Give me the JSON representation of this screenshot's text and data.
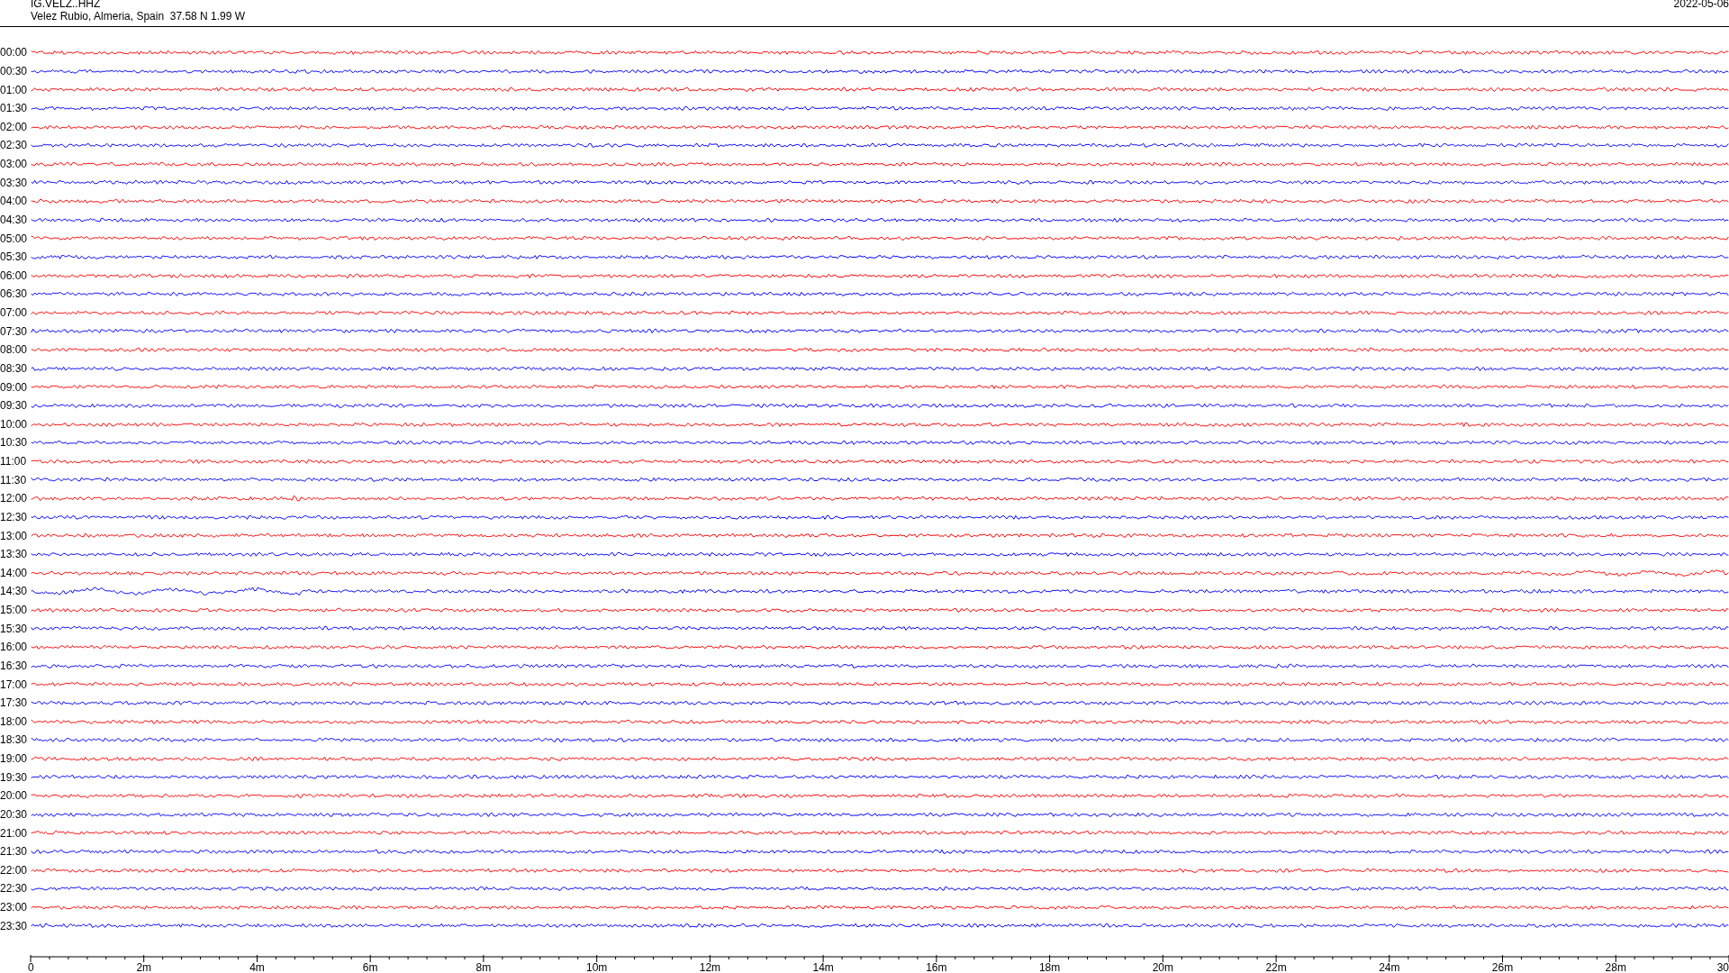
{
  "header": {
    "station": "IG.VELZ..HHZ",
    "location": "Velez Rubio, Almeria, Spain  37.58 N 1.99 W",
    "date": "2022-05-06"
  },
  "rows": [
    {
      "label": "00:00",
      "color": "#ff0000"
    },
    {
      "label": "00:30",
      "color": "#0000ff"
    },
    {
      "label": "01:00",
      "color": "#ff0000"
    },
    {
      "label": "01:30",
      "color": "#0000ff"
    },
    {
      "label": "02:00",
      "color": "#ff0000"
    },
    {
      "label": "02:30",
      "color": "#0000ff"
    },
    {
      "label": "03:00",
      "color": "#ff0000"
    },
    {
      "label": "03:30",
      "color": "#0000ff"
    },
    {
      "label": "04:00",
      "color": "#ff0000"
    },
    {
      "label": "04:30",
      "color": "#0000ff"
    },
    {
      "label": "05:00",
      "color": "#ff0000"
    },
    {
      "label": "05:30",
      "color": "#0000ff"
    },
    {
      "label": "06:00",
      "color": "#ff0000"
    },
    {
      "label": "06:30",
      "color": "#0000ff"
    },
    {
      "label": "07:00",
      "color": "#ff0000"
    },
    {
      "label": "07:30",
      "color": "#0000ff"
    },
    {
      "label": "08:00",
      "color": "#ff0000"
    },
    {
      "label": "08:30",
      "color": "#0000ff"
    },
    {
      "label": "09:00",
      "color": "#ff0000"
    },
    {
      "label": "09:30",
      "color": "#0000ff"
    },
    {
      "label": "10:00",
      "color": "#ff0000"
    },
    {
      "label": "10:30",
      "color": "#0000ff"
    },
    {
      "label": "11:00",
      "color": "#ff0000"
    },
    {
      "label": "11:30",
      "color": "#0000ff"
    },
    {
      "label": "12:00",
      "color": "#ff0000"
    },
    {
      "label": "12:30",
      "color": "#0000ff"
    },
    {
      "label": "13:00",
      "color": "#ff0000"
    },
    {
      "label": "13:30",
      "color": "#0000ff"
    },
    {
      "label": "14:00",
      "color": "#ff0000"
    },
    {
      "label": "14:30",
      "color": "#0000ff"
    },
    {
      "label": "15:00",
      "color": "#ff0000"
    },
    {
      "label": "15:30",
      "color": "#0000ff"
    },
    {
      "label": "16:00",
      "color": "#ff0000"
    },
    {
      "label": "16:30",
      "color": "#0000ff"
    },
    {
      "label": "17:00",
      "color": "#ff0000"
    },
    {
      "label": "17:30",
      "color": "#0000ff"
    },
    {
      "label": "18:00",
      "color": "#ff0000"
    },
    {
      "label": "18:30",
      "color": "#0000ff"
    },
    {
      "label": "19:00",
      "color": "#ff0000"
    },
    {
      "label": "19:30",
      "color": "#0000ff"
    },
    {
      "label": "20:00",
      "color": "#ff0000"
    },
    {
      "label": "20:30",
      "color": "#0000ff"
    },
    {
      "label": "21:00",
      "color": "#ff0000"
    },
    {
      "label": "21:30",
      "color": "#0000ff"
    },
    {
      "label": "22:00",
      "color": "#ff0000"
    },
    {
      "label": "22:30",
      "color": "#0000ff"
    },
    {
      "label": "23:00",
      "color": "#ff0000"
    },
    {
      "label": "23:30",
      "color": "#0000ff"
    }
  ],
  "time_axis": {
    "labels": [
      "0",
      "2m",
      "4m",
      "6m",
      "8m",
      "10m",
      "12m",
      "14m",
      "16m",
      "18m",
      "20m",
      "22m",
      "24m",
      "26m",
      "28m",
      "30"
    ]
  }
}
